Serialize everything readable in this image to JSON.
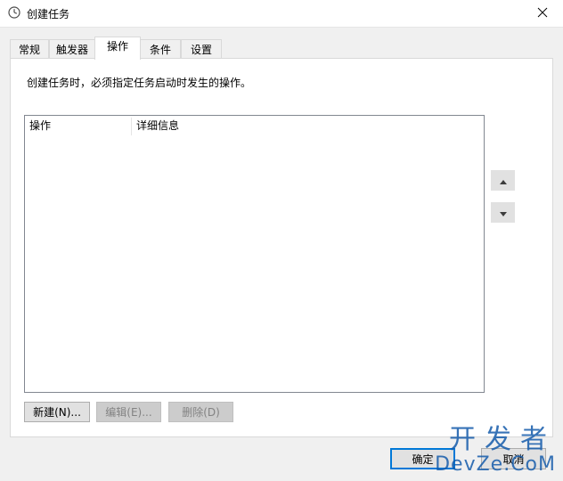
{
  "window": {
    "title": "创建任务",
    "icon": "clock-icon",
    "close_icon": "close-icon"
  },
  "tabs": [
    {
      "label": "常规",
      "active": false
    },
    {
      "label": "触发器",
      "active": false
    },
    {
      "label": "操作",
      "active": true
    },
    {
      "label": "条件",
      "active": false
    },
    {
      "label": "设置",
      "active": false
    }
  ],
  "actions_tab": {
    "description": "创建任务时，必须指定任务启动时发生的操作。",
    "table": {
      "columns": [
        "操作",
        "详细信息"
      ],
      "rows": []
    },
    "move_up_icon": "triangle-up-icon",
    "move_down_icon": "triangle-down-icon",
    "buttons": {
      "new": "新建(N)...",
      "edit": "编辑(E)...",
      "delete": "删除(D)"
    }
  },
  "footer": {
    "ok": "确定",
    "cancel": "取消"
  },
  "watermark": {
    "top": "开发者",
    "bottom": "DevZe.CoM"
  },
  "colors": {
    "accent": "#0078d7",
    "disabled_text": "#838383",
    "panel_border": "#d9d9d9"
  }
}
